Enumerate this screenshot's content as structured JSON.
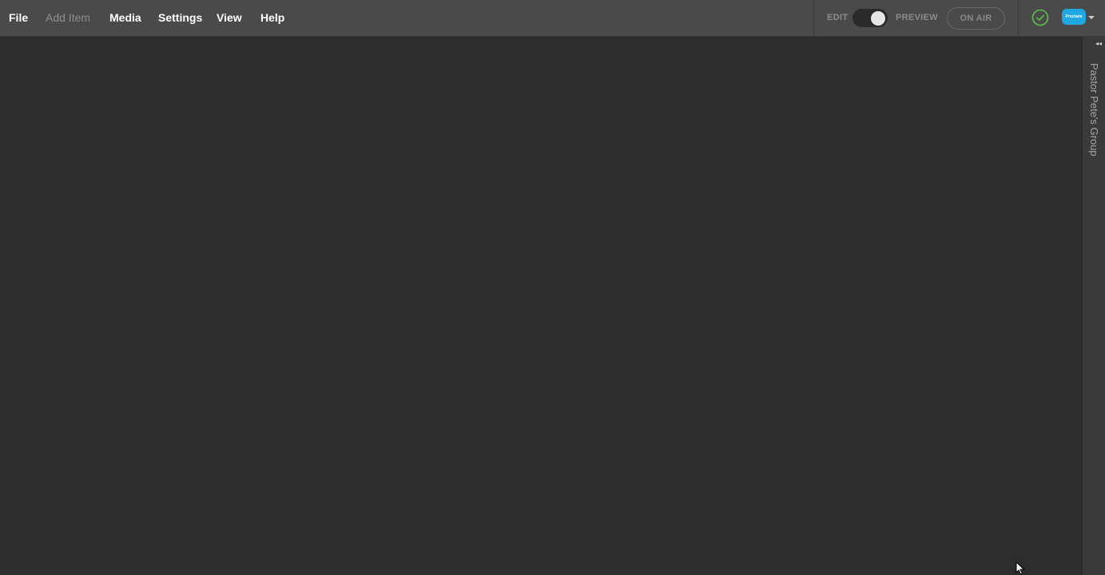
{
  "menu": {
    "file": "File",
    "add_item": "Add Item",
    "media": "Media",
    "settings": "Settings",
    "view": "View",
    "help": "Help"
  },
  "mode": {
    "edit_label": "EDIT",
    "preview_label": "PREVIEW",
    "toggle_state": "preview",
    "on_air_label": "ON AIR"
  },
  "status": {
    "icon": "check-circle-icon",
    "color": "#5cc24a"
  },
  "account": {
    "avatar_text": "Proclaim",
    "avatar_color": "#1fa7e1"
  },
  "side_panel": {
    "tab_label": "Pastor Pete's Group"
  },
  "colors": {
    "topbar": "#4a4a4a",
    "canvas": "#2d2d2d",
    "side_panel": "#3a3a3a"
  }
}
